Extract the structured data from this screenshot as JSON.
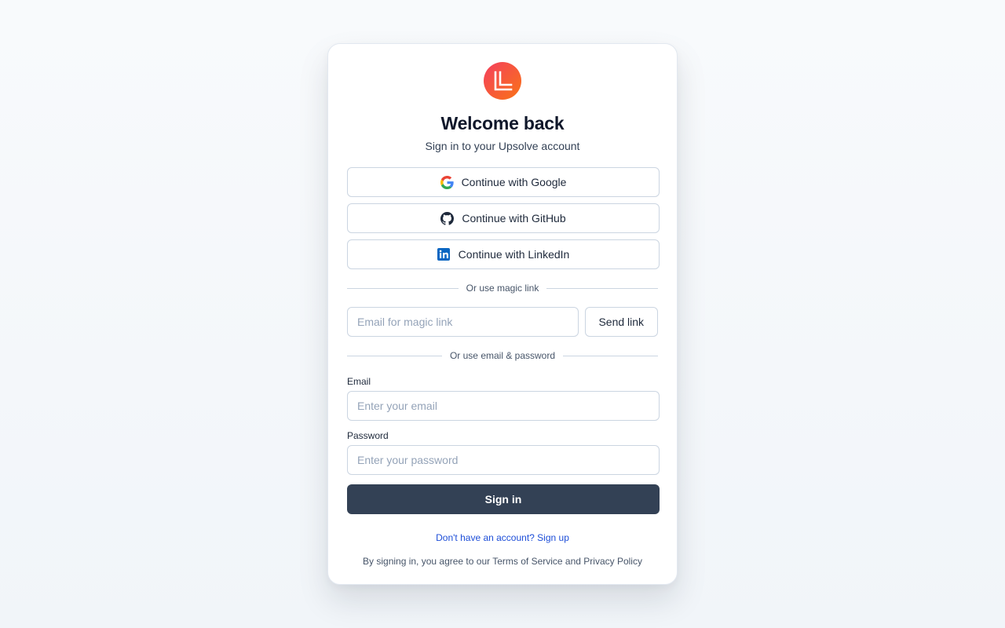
{
  "header": {
    "title": "Welcome back",
    "subtitle": "Sign in to your Upsolve account"
  },
  "oauth": {
    "google_label": "Continue with Google",
    "github_label": "Continue with GitHub",
    "linkedin_label": "Continue with LinkedIn"
  },
  "magic": {
    "divider_label": "Or use magic link",
    "email_placeholder": "Email for magic link",
    "send_label": "Send link"
  },
  "credentials": {
    "divider_label": "Or use email & password",
    "email_label": "Email",
    "email_placeholder": "Enter your email",
    "password_label": "Password",
    "password_placeholder": "Enter your password",
    "signin_label": "Sign in"
  },
  "footer": {
    "signup_text": "Don't have an account? Sign up",
    "terms_text": "By signing in, you agree to our Terms of Service and Privacy Policy"
  },
  "icons": {
    "logo": "brand-logo-icon",
    "google": "google-icon",
    "github": "github-icon",
    "linkedin": "linkedin-icon"
  },
  "colors": {
    "logo_gradient_start": "#f43f5e",
    "logo_gradient_end": "#f97316",
    "primary_button": "#334155",
    "link": "#1d4ed8",
    "linkedin": "#0a66c2"
  }
}
